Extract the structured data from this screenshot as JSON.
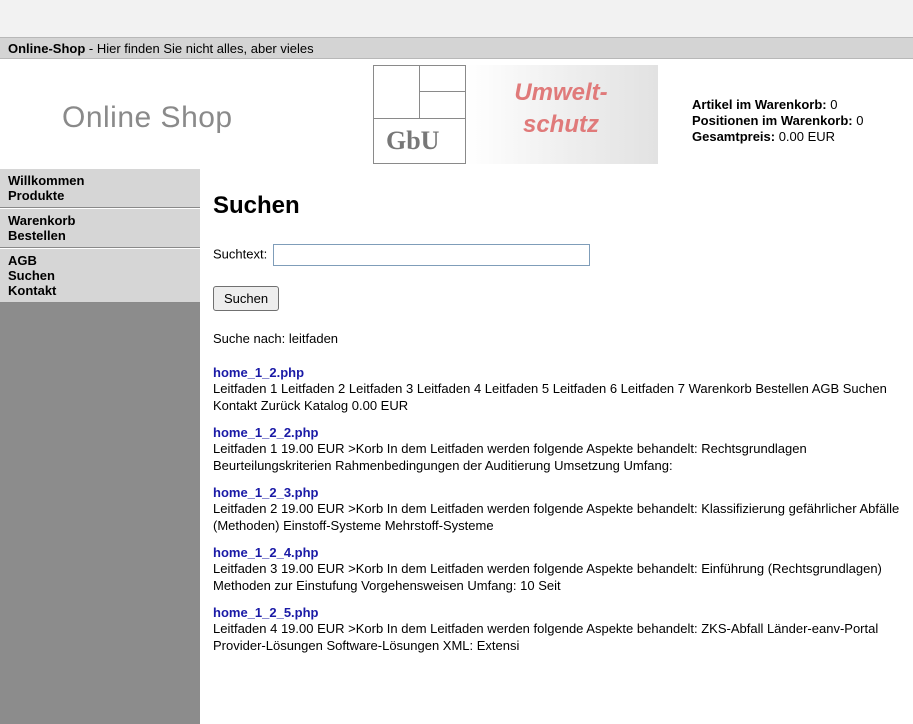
{
  "title_bar": {
    "shop_name": "Online-Shop",
    "tagline": " - Hier finden Sie nicht alles, aber vieles"
  },
  "header": {
    "logo_text": "Online Shop",
    "gbu_text": "GbU",
    "umwelt_text": "Umwelt-",
    "schutz_text": "schutz",
    "cart": {
      "items_label": "Artikel im Warenkorb:",
      "items_value": " 0",
      "positions_label": "Positionen im Warenkorb:",
      "positions_value": " 0",
      "total_label": "Gesamtpreis:",
      "total_value": " 0.00 EUR"
    }
  },
  "sidebar": {
    "groups": [
      [
        "Willkommen",
        "Produkte"
      ],
      [
        "Warenkorb",
        "Bestellen"
      ],
      [
        "AGB",
        "Suchen",
        "Kontakt"
      ]
    ]
  },
  "main": {
    "title": "Suchen",
    "search_label": "Suchtext:",
    "search_value": "",
    "search_button": "Suchen",
    "search_for": "Suche nach: leitfaden",
    "results": [
      {
        "link": "home_1_2.php",
        "text": "Leitfaden 1 Leitfaden 2 Leitfaden 3 Leitfaden 4 Leitfaden 5 Leitfaden 6 Leitfaden 7 Warenkorb Bestellen AGB Suchen Kontakt Zurück Katalog 0.00 EUR"
      },
      {
        "link": "home_1_2_2.php",
        "text": "Leitfaden 1 19.00 EUR >Korb In dem Leitfaden werden folgende Aspekte behandelt: Rechtsgrundlagen Beurteilungskriterien Rahmenbedingungen der Auditierung Umsetzung Umfang:"
      },
      {
        "link": "home_1_2_3.php",
        "text": "Leitfaden 2 19.00 EUR >Korb In dem Leitfaden werden folgende Aspekte behandelt: Klassifizierung gefährlicher Abfälle (Methoden) Einstoff-Systeme Mehrstoff-Systeme"
      },
      {
        "link": "home_1_2_4.php",
        "text": "Leitfaden 3 19.00 EUR >Korb In dem Leitfaden werden folgende Aspekte behandelt: Einführung (Rechtsgrundlagen) Methoden zur Einstufung Vorgehensweisen Umfang: 10 Seit"
      },
      {
        "link": "home_1_2_5.php",
        "text": "Leitfaden 4 19.00 EUR >Korb In dem Leitfaden werden folgende Aspekte behandelt: ZKS-Abfall Länder-eanv-Portal Provider-Lösungen Software-Lösungen XML: Extensi"
      }
    ]
  }
}
